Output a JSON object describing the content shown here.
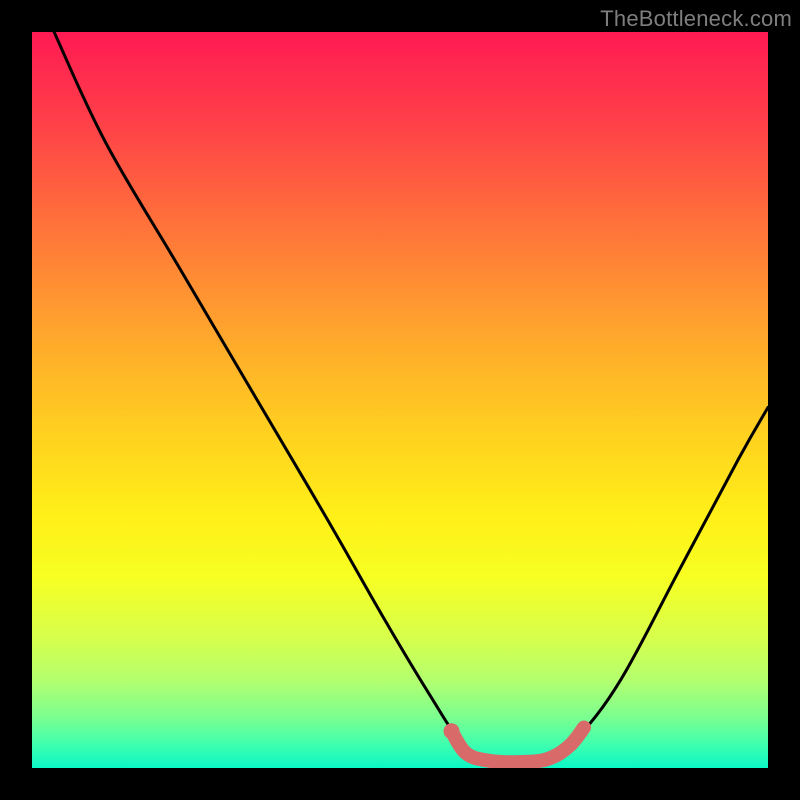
{
  "watermark": "TheBottleneck.com",
  "chart_data": {
    "type": "line",
    "title": "",
    "xlabel": "",
    "ylabel": "",
    "xlim": [
      0,
      100
    ],
    "ylim": [
      0,
      100
    ],
    "grid": false,
    "legend": false,
    "series": [
      {
        "name": "bottleneck-curve",
        "color": "#000000",
        "points": [
          {
            "x": 3,
            "y": 100
          },
          {
            "x": 10,
            "y": 85
          },
          {
            "x": 20,
            "y": 68
          },
          {
            "x": 30,
            "y": 51
          },
          {
            "x": 40,
            "y": 34
          },
          {
            "x": 48,
            "y": 20
          },
          {
            "x": 54,
            "y": 10
          },
          {
            "x": 58,
            "y": 4
          },
          {
            "x": 62,
            "y": 1
          },
          {
            "x": 66,
            "y": 0.5
          },
          {
            "x": 70,
            "y": 1
          },
          {
            "x": 74,
            "y": 4
          },
          {
            "x": 80,
            "y": 12
          },
          {
            "x": 88,
            "y": 27
          },
          {
            "x": 96,
            "y": 42
          },
          {
            "x": 100,
            "y": 49
          }
        ]
      },
      {
        "name": "sweet-spot",
        "color": "#d96a6a",
        "points": [
          {
            "x": 57,
            "y": 5
          },
          {
            "x": 59,
            "y": 2
          },
          {
            "x": 62,
            "y": 1
          },
          {
            "x": 66,
            "y": 0.8
          },
          {
            "x": 70,
            "y": 1.2
          },
          {
            "x": 73,
            "y": 3
          },
          {
            "x": 75,
            "y": 5.5
          }
        ]
      }
    ],
    "marker": {
      "x": 57,
      "y": 5,
      "color": "#d96a6a"
    },
    "background_gradient": {
      "from": "#ff1a53",
      "mid": "#ffe81f",
      "to": "#0bf7c7"
    }
  }
}
